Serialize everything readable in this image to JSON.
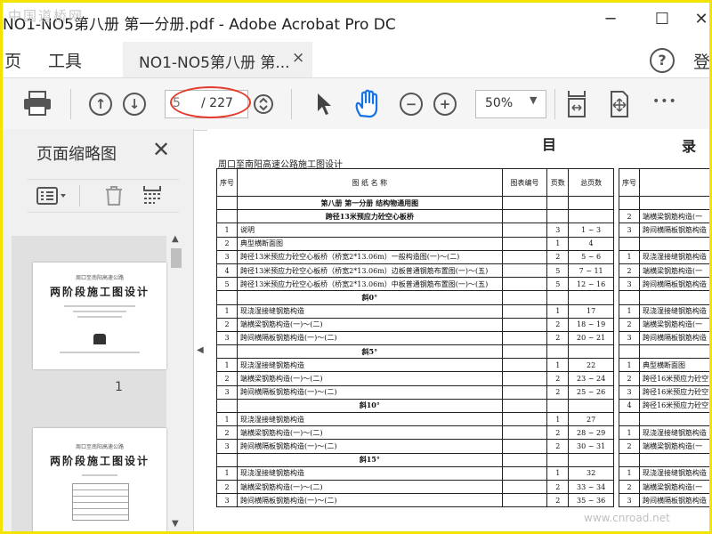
{
  "window": {
    "title": "NO1-NO5第八册 第一分册.pdf - Adobe Acrobat Pro DC",
    "watermark": "中国道桥网",
    "minimize": "─",
    "maximize": "☐",
    "close": "✕"
  },
  "menubar": {
    "home": "页",
    "tools": "工具",
    "tab_label": "NO1-NO5第八册 第...",
    "tab_close": "×",
    "help": "?",
    "login": "登"
  },
  "toolbar": {
    "current_page": "5",
    "total_pages": "/ 227",
    "zoom": "50%",
    "zoom_caret": "▼",
    "more": "•••"
  },
  "left_panel": {
    "title": "页面缩略图",
    "close": "✕",
    "thumbs": [
      {
        "subtitle": "周口至南阳高速公路",
        "title": "两阶段施工图设计",
        "number": "1"
      },
      {
        "subtitle": "周口至南阳高速公路",
        "title": "两阶段施工图设计",
        "number": ""
      }
    ]
  },
  "document": {
    "heading_left": "目",
    "heading_right": "录",
    "subtitle": "周口至南阳高速公路施工图设计",
    "headers": {
      "no": "序号",
      "name": "图 纸 名 称",
      "code": "图表编号",
      "pages": "页数",
      "total": "总页数",
      "no2": "序号"
    },
    "rows": [
      {
        "type": "sec",
        "name": "第八册  第一分册  结构物通用图"
      },
      {
        "type": "sec",
        "name": "跨径13米预应力砼空心板桥"
      },
      {
        "no": "1",
        "name": "说明",
        "p": "3",
        "t": "1  ~  3"
      },
      {
        "no": "2",
        "name": "典型横断面图",
        "p": "1",
        "t": "4"
      },
      {
        "no": "3",
        "name": "跨径13米预应力砼空心板桥（桥宽2*13.06m）一般构造图(一)～(二)",
        "p": "2",
        "t": "5  ~  6"
      },
      {
        "no": "4",
        "name": "跨径13米预应力砼空心板桥（桥宽2*13.06m）边板普通钢筋布置图(一)～(五)",
        "p": "5",
        "t": "7  ~  11"
      },
      {
        "no": "5",
        "name": "跨径13米预应力砼空心板桥（桥宽2*13.06m）中板普通钢筋布置图(一)～(五)",
        "p": "5",
        "t": "12  ~  16"
      },
      {
        "type": "sec",
        "name": "斜0°"
      },
      {
        "no": "1",
        "name": "现浇湿接缝钢筋构造",
        "p": "1",
        "t": "17"
      },
      {
        "no": "2",
        "name": "端横梁钢筋构造(一)～(二)",
        "p": "2",
        "t": "18  ~  19"
      },
      {
        "no": "3",
        "name": "跨间横隔板钢筋构造(一)～(二)",
        "p": "2",
        "t": "20  ~  21"
      },
      {
        "type": "sec",
        "name": "斜5°"
      },
      {
        "no": "1",
        "name": "现浇湿接缝钢筋构造",
        "p": "1",
        "t": "22"
      },
      {
        "no": "2",
        "name": "端横梁钢筋构造(一)～(二)",
        "p": "2",
        "t": "23  ~  24"
      },
      {
        "no": "3",
        "name": "跨间横隔板钢筋构造(一)～(二)",
        "p": "2",
        "t": "25  ~  26"
      },
      {
        "type": "sec",
        "name": "斜10°"
      },
      {
        "no": "1",
        "name": "现浇湿接缝钢筋构造",
        "p": "1",
        "t": "27"
      },
      {
        "no": "2",
        "name": "端横梁钢筋构造(一)～(二)",
        "p": "2",
        "t": "28  ~  29"
      },
      {
        "no": "3",
        "name": "跨间横隔板钢筋构造(一)～(二)",
        "p": "2",
        "t": "30  ~  31"
      },
      {
        "type": "sec",
        "name": "斜15°"
      },
      {
        "no": "1",
        "name": "现浇湿接缝钢筋构造",
        "p": "1",
        "t": "32"
      },
      {
        "no": "2",
        "name": "端横梁钢筋构造(一)～(二)",
        "p": "2",
        "t": "33  ~  34"
      },
      {
        "no": "3",
        "name": "跨间横隔板钢筋构造(一)～(二)",
        "p": "2",
        "t": "35  ~  36"
      }
    ],
    "right_rows": [
      {
        "no": "",
        "name": ""
      },
      {
        "no": "2",
        "name": "端横梁钢筋构造(一"
      },
      {
        "no": "3",
        "name": "跨间横隔板钢筋构造"
      },
      {
        "no": "",
        "name": ""
      },
      {
        "no": "1",
        "name": "现浇湿接缝钢筋构造"
      },
      {
        "no": "2",
        "name": "端横梁钢筋构造(一"
      },
      {
        "no": "3",
        "name": "跨间横隔板钢筋构造"
      },
      {
        "no": "",
        "name": ""
      },
      {
        "no": "1",
        "name": "现浇湿接缝钢筋构造"
      },
      {
        "no": "2",
        "name": "端横梁钢筋构造(一"
      },
      {
        "no": "3",
        "name": "跨间横隔板钢筋构造"
      },
      {
        "no": "",
        "name": ""
      },
      {
        "no": "1",
        "name": "典型横断面图"
      },
      {
        "no": "2",
        "name": "跨径16米预应力砼空"
      },
      {
        "no": "3",
        "name": "跨径16米预应力砼空"
      },
      {
        "no": "4",
        "name": "跨径16米预应力砼空"
      },
      {
        "no": "",
        "name": ""
      },
      {
        "no": "1",
        "name": "现浇湿接缝钢筋构造"
      },
      {
        "no": "2",
        "name": "端横梁钢筋构造(一"
      },
      {
        "no": "",
        "name": ""
      },
      {
        "no": "1",
        "name": "现浇湿接缝钢筋构造"
      },
      {
        "no": "2",
        "name": "端横梁钢筋构造(一"
      },
      {
        "no": "3",
        "name": "跨间横隔板钢筋构造"
      }
    ]
  },
  "footer_watermark": "www.cnroad.net",
  "colors": {
    "highlight_border": "#f3e400",
    "page_ring": "#e53b2c",
    "hand_tool": "#1473e6"
  }
}
